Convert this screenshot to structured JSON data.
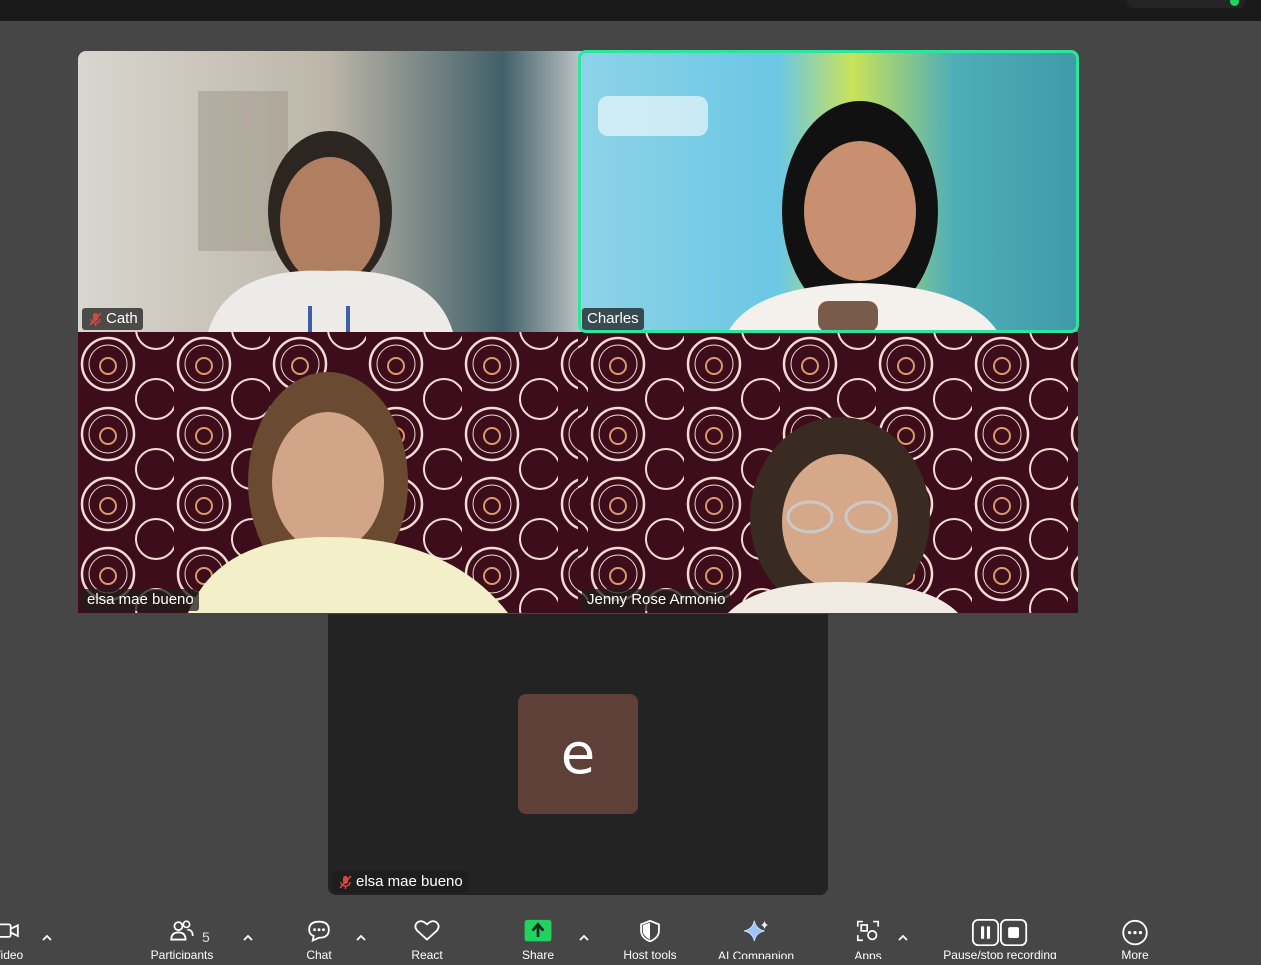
{
  "top_bar": {
    "indicator_color": "#23d160"
  },
  "participants": [
    {
      "name": "Cath",
      "muted": true
    },
    {
      "name": "Charles",
      "muted": false,
      "active_speaker": true
    },
    {
      "name": "elsa mae bueno",
      "muted": false
    },
    {
      "name": "Jenny Rose Armonio",
      "muted": false
    }
  ],
  "avatar_tile": {
    "initial": "e",
    "name": "elsa mae bueno",
    "muted": true,
    "avatar_color": "#5e4038"
  },
  "colors": {
    "active_speaker_border": "#2ee69b",
    "share_green": "#23d160",
    "background": "#464646"
  },
  "toolbar": {
    "video": {
      "label": "Video",
      "icon": "video-camera-icon"
    },
    "participants": {
      "label": "Participants",
      "count": "5",
      "icon": "people-icon"
    },
    "chat": {
      "label": "Chat",
      "icon": "chat-icon"
    },
    "react": {
      "label": "React",
      "icon": "heart-icon"
    },
    "share": {
      "label": "Share",
      "icon": "share-arrow-icon"
    },
    "host_tools": {
      "label": "Host tools",
      "icon": "shield-icon"
    },
    "ai_companion": {
      "label": "AI Companion",
      "icon": "sparkle-icon"
    },
    "apps": {
      "label": "Apps",
      "icon": "apps-icon"
    },
    "record": {
      "label": "Pause/stop recording",
      "icon": "pause-stop-icon"
    },
    "more": {
      "label": "More",
      "icon": "more-icon"
    }
  }
}
